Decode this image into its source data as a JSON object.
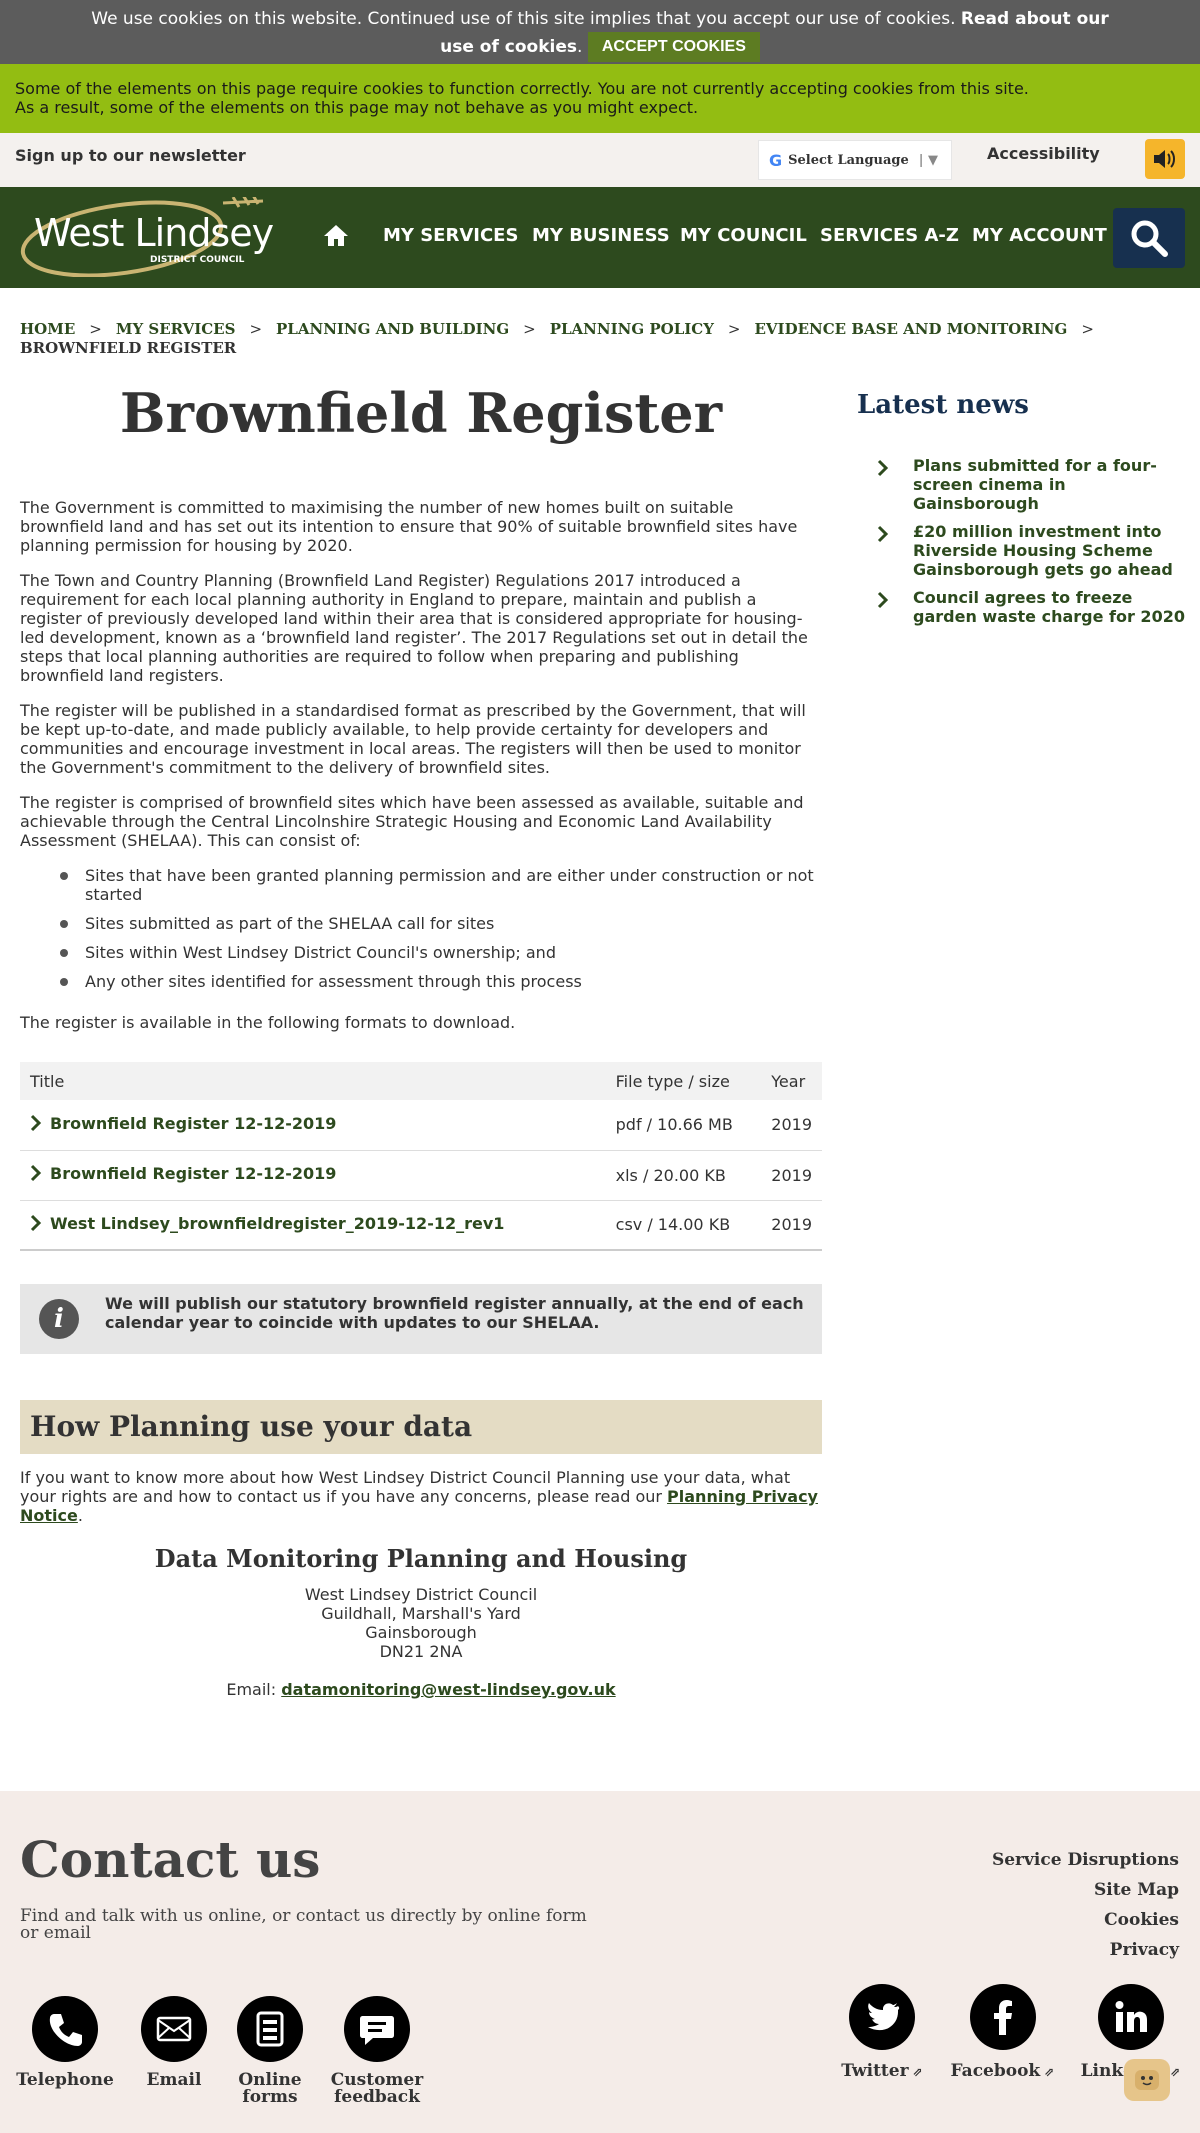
{
  "cookie_bar": {
    "text": "We use cookies on this website. Continued use of this site implies that you accept our use of cookies.",
    "link": "Read about our use of cookies",
    "button": "ACCEPT COOKIES"
  },
  "warning_bar": {
    "line1": "Some of the elements on this page require cookies to function correctly. You are not currently accepting cookies from this site.",
    "line2": "As a result, some of the elements on this page may not behave as you might expect."
  },
  "utility": {
    "newsletter": "Sign up to our newsletter",
    "language": "Select Language",
    "accessibility": "Accessibility"
  },
  "nav": {
    "logo_text": "West Lindsey",
    "logo_sub": "DISTRICT COUNCIL",
    "items": [
      "MY SERVICES",
      "MY BUSINESS",
      "MY COUNCIL",
      "SERVICES A-Z",
      "MY ACCOUNT"
    ]
  },
  "breadcrumb": [
    "HOME",
    "MY SERVICES",
    "PLANNING AND BUILDING",
    "PLANNING POLICY",
    "EVIDENCE BASE AND MONITORING",
    "BROWNFIELD REGISTER"
  ],
  "main": {
    "title": "Brownfield Register",
    "paragraphs": [
      "The Government is committed to maximising  the number of new homes built on suitable brownfield land and has set out its intention to ensure that 90% of suitable brownfield sites have planning permission for housing by 2020.",
      "The Town and Country Planning (Brownfield Land Register) Regulations 2017 introduced a requirement for each local planning authority in England to prepare, maintain and publish a register of previously developed land within their area that is considered appropriate for housing-led development, known as a ‘brownfield land register’. The 2017 Regulations set out in detail the steps that local planning authorities are required to follow when preparing and publishing brownfield land registers.",
      "The register will be published in a standardised format as prescribed by the Government, that will be kept up-to-date, and made publicly available, to help provide certainty for developers and communities and encourage investment in local areas. The registers will then be used to monitor the Government's commitment to the delivery of brownfield sites.",
      "The register is comprised of brownfield sites which have been assessed as available, suitable and achievable through the Central Lincolnshire Strategic Housing and Economic Land Availability Assessment (SHELAA). This can consist of:"
    ],
    "bullets": [
      "Sites that have been granted planning permission and are either under construction or not started",
      "Sites submitted as part of the SHELAA call for sites",
      "Sites within West Lindsey District Council's ownership; and",
      "Any other sites identified for assessment through this process"
    ],
    "download_intro": "The register is available in the following formats to download.",
    "table": {
      "headers": [
        "Title",
        "File type / size",
        "Year"
      ],
      "rows": [
        {
          "title": "Brownfield Register 12-12-2019",
          "type": "pdf / 10.66 MB",
          "year": "2019"
        },
        {
          "title": "Brownfield Register 12-12-2019",
          "type": "xls / 20.00 KB",
          "year": "2019"
        },
        {
          "title": "West Lindsey_brownfieldregister_2019-12-12_rev1",
          "type": "csv / 14.00 KB",
          "year": "2019"
        }
      ]
    },
    "info": "We will publish our statutory brownfield register annually, at the end of each calendar year to coincide with updates to our SHELAA.",
    "data_heading": "How Planning use your data",
    "data_text": "If you want to know more about how West Lindsey District Council Planning use your data, what your rights are and how to contact us if you have any concerns, please read our",
    "data_link": "Planning Privacy Notice",
    "contact_block": {
      "heading": "Data Monitoring Planning and Housing",
      "address": [
        "West Lindsey District Council",
        "Guildhall, Marshall's Yard",
        "Gainsborough",
        "DN21 2NA"
      ],
      "email_label": "Email:",
      "email": "datamonitoring@west-lindsey.gov.uk"
    }
  },
  "sidebar": {
    "heading": "Latest news",
    "news": [
      "Plans submitted for a four-screen cinema in Gainsborough",
      "£20 million investment into Riverside Housing Scheme Gainsborough gets go ahead",
      "Council agrees to freeze garden waste charge for 2020"
    ]
  },
  "footer": {
    "heading": "Contact us",
    "sub": "Find and talk with us online, or contact us directly by online form or email",
    "links": [
      "Service Disruptions",
      "Site Map",
      "Cookies",
      "Privacy"
    ],
    "contact_icons": [
      {
        "label": "Telephone",
        "icon": "phone-icon"
      },
      {
        "label": "Email",
        "icon": "envelope-icon"
      },
      {
        "label": "Online forms",
        "icon": "form-icon"
      },
      {
        "label": "Customer feedback",
        "icon": "chat-bubble-icon"
      }
    ],
    "social": [
      "Twitter",
      "Facebook",
      "LinkedIn"
    ]
  },
  "colors": {
    "nav_green": "#2d4a1e",
    "warning_green": "#93bd12",
    "navy": "#17304f",
    "accent_yellow": "#f5b52b"
  }
}
